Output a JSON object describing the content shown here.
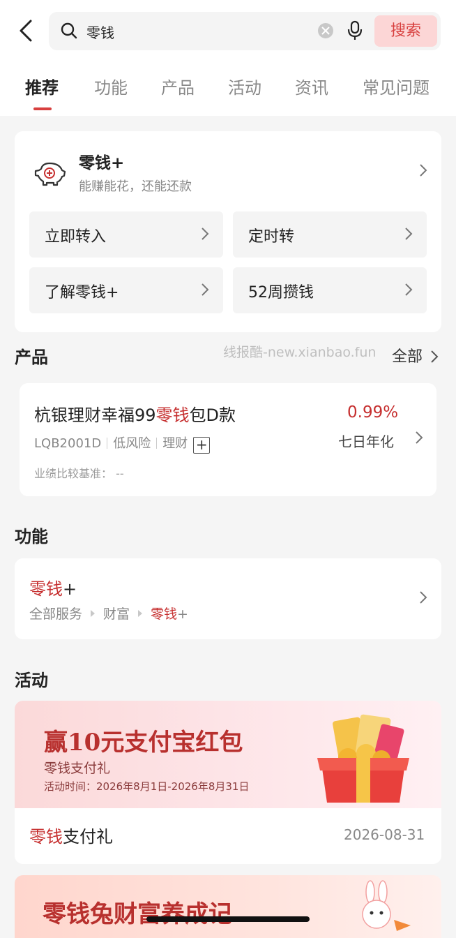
{
  "search": {
    "query": "零钱",
    "button": "搜索"
  },
  "tabs": [
    "推荐",
    "功能",
    "产品",
    "活动",
    "资讯",
    "常见问题"
  ],
  "hero": {
    "title": "零钱+",
    "subtitle": "能赚能花，还能还款",
    "buttons": [
      "立即转入",
      "定时转",
      "了解零钱+",
      "52周攒钱"
    ]
  },
  "products": {
    "section_title": "产品",
    "watermark": "线报酷-new.xianbao.fun",
    "all_label": "全部",
    "item": {
      "title_before": "杭银理财幸福99",
      "title_highlight": "零钱",
      "title_after": "包D款",
      "code": "LQB2001D",
      "risk": "低风险",
      "category": "理财",
      "benchmark": "业绩比较基准： --",
      "rate": "0.99%",
      "rate_label": "七日年化"
    }
  },
  "functions": {
    "section_title": "功能",
    "item": {
      "title_highlight": "零钱",
      "title_rest": "+",
      "crumb1": "全部服务",
      "crumb2": "财富",
      "crumb3_highlight": "零钱",
      "crumb3_rest": "+"
    }
  },
  "activities": {
    "section_title": "活动",
    "banner": {
      "headline": "赢10元支付宝红包",
      "sub": "零钱支付礼",
      "time": "活动时间：2026年8月1日-2026年8月31日"
    },
    "item": {
      "title_highlight": "零钱",
      "title_rest": "支付礼",
      "date": "2026-08-31"
    },
    "banner2_headline": "零钱兔财富养成记"
  },
  "colors": {
    "accent": "#c62f2f",
    "search_button_bg": "#fcd6d6"
  }
}
